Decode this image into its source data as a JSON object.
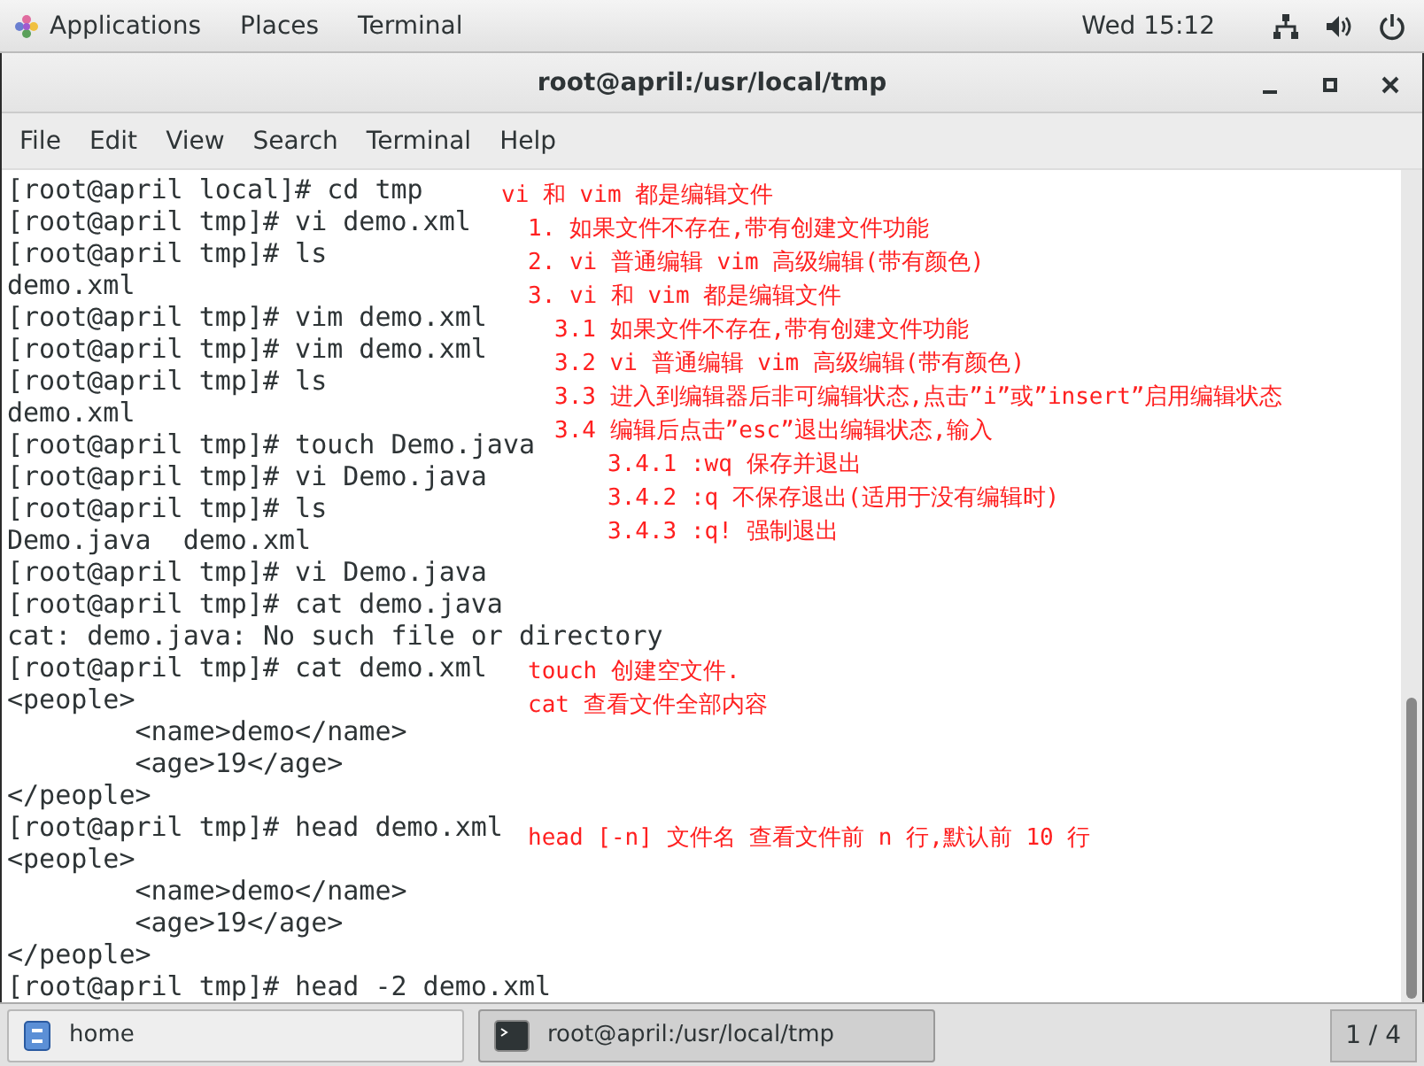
{
  "top_bar": {
    "menus": [
      "Applications",
      "Places",
      "Terminal"
    ],
    "clock": "Wed 15:12"
  },
  "window": {
    "title": "root@april:/usr/local/tmp"
  },
  "menu_bar": [
    "File",
    "Edit",
    "View",
    "Search",
    "Terminal",
    "Help"
  ],
  "terminal": {
    "lines": [
      "[root@april local]# cd tmp",
      "[root@april tmp]# vi demo.xml",
      "[root@april tmp]# ls",
      "demo.xml",
      "[root@april tmp]# vim demo.xml",
      "[root@april tmp]# vim demo.xml",
      "[root@april tmp]# ls",
      "demo.xml",
      "[root@april tmp]# touch Demo.java",
      "[root@april tmp]# vi Demo.java",
      "[root@april tmp]# ls",
      "Demo.java  demo.xml",
      "[root@april tmp]# vi Demo.java",
      "[root@april tmp]# cat demo.java",
      "cat: demo.java: No such file or directory",
      "[root@april tmp]# cat demo.xml",
      "<people>",
      "        <name>demo</name>",
      "        <age>19</age>",
      "</people>",
      "[root@april tmp]# head demo.xml",
      "<people>",
      "        <name>demo</name>",
      "        <age>19</age>",
      "</people>",
      "[root@april tmp]# head -2 demo.xml"
    ]
  },
  "annotations": [
    [
      {
        "text": "vi 和 vim 都是编辑文件",
        "children": [
          {
            "text": "1. 如果文件不存在,带有创建文件功能"
          },
          {
            "text": "2. vi 普通编辑 vim 高级编辑(带有颜色)"
          },
          {
            "text": "3. vi 和 vim 都是编辑文件",
            "children": [
              {
                "text": "3.1 如果文件不存在,带有创建文件功能"
              },
              {
                "text": "3.2 vi 普通编辑 vim 高级编辑(带有颜色)"
              },
              {
                "text": "3.3 进入到编辑器后非可编辑状态,点击”i”或”insert”启用编辑状态"
              },
              {
                "text": "3.4 编辑后点击”esc”退出编辑状态,输入",
                "children": [
                  {
                    "text": "3.4.1 :wq 保存并退出"
                  },
                  {
                    "text": "3.4.2 :q 不保存退出(适用于没有编辑时)"
                  },
                  {
                    "text": "3.4.3 :q! 强制退出"
                  }
                ]
              }
            ]
          }
        ]
      }
    ],
    [
      {
        "text": "touch 创建空文件."
      },
      {
        "text": "cat 查看文件全部内容"
      }
    ],
    [
      {
        "text": "head [-n] 文件名 查看文件前 n 行,默认前 10 行"
      }
    ]
  ],
  "taskbar": {
    "items": [
      {
        "kind": "folder",
        "label": "home",
        "selected": false
      },
      {
        "kind": "terminal",
        "label": "root@april:/usr/local/tmp",
        "selected": true
      }
    ],
    "workspace": "1 / 4"
  }
}
